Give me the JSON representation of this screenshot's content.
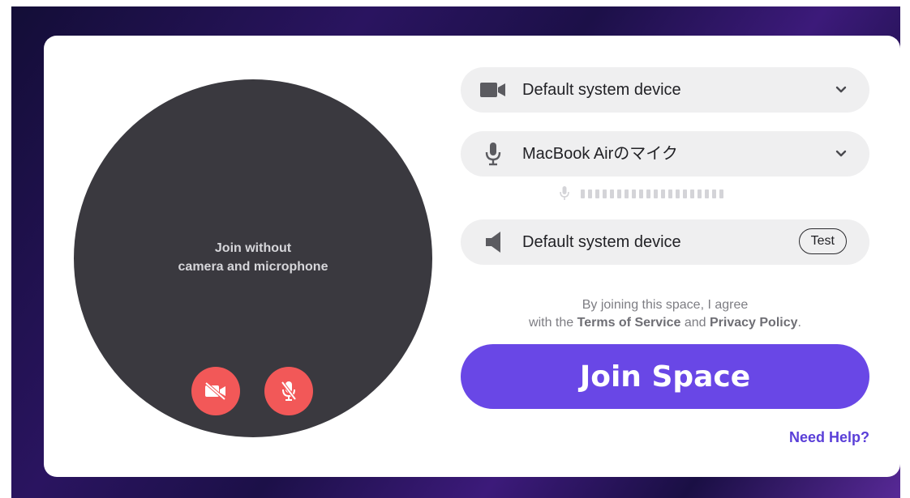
{
  "preview": {
    "line1": "Join without",
    "line2": "camera and microphone",
    "camera_button": {
      "icon": "camera-off-icon",
      "color": "#f25858"
    },
    "mic_button": {
      "icon": "mic-off-icon",
      "color": "#f25858"
    }
  },
  "devices": {
    "camera": {
      "icon": "video-camera-icon",
      "label": "Default system device"
    },
    "microphone": {
      "icon": "microphone-icon",
      "label": "MacBook Airのマイク",
      "level_percent": 0
    },
    "speaker": {
      "icon": "speaker-icon",
      "label": "Default system device",
      "test_label": "Test"
    }
  },
  "terms": {
    "line1": "By joining this space, I agree",
    "prefix": "with the",
    "terms_link": "Terms of Service",
    "and": "and",
    "privacy_link": "Privacy Policy",
    "suffix": "."
  },
  "join_button": {
    "label": "Join Space",
    "color": "#6947e6"
  },
  "help_link": {
    "label": "Need Help?",
    "color": "#5a3fd8"
  }
}
